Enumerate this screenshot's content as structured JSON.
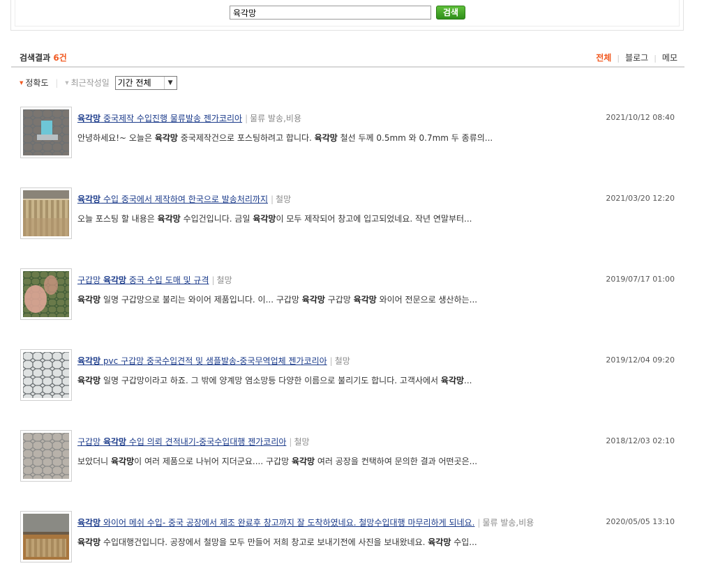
{
  "search": {
    "value": "육각망",
    "button_label": "검색"
  },
  "results_header": {
    "label": "검색결과",
    "count": "6건"
  },
  "view_tabs": [
    "전체",
    "블로그",
    "메모"
  ],
  "sort": {
    "accuracy": "정확도",
    "recent": "최근작성일",
    "period": "기간 전체"
  },
  "results": [
    {
      "title": [
        [
          "육각망",
          true
        ],
        [
          " 중국제작 수입진행 물류발송 젠가코리아",
          false
        ]
      ],
      "category": "물류 발송,비용",
      "date": "2021/10/12 08:40",
      "desc": [
        [
          "안녕하세요!~ 오늘은 ",
          false
        ],
        [
          "육각망",
          true
        ],
        [
          " 중국제작건으로 포스팅하려고 합니다. ",
          false
        ],
        [
          "육각망",
          true
        ],
        [
          " 철선 두께 0.5mm 와 0.7mm 두 종류의...",
          false
        ]
      ]
    },
    {
      "title": [
        [
          "육각망",
          true
        ],
        [
          " 수입 중국에서 제작하여 한국으로 발송처리까지",
          false
        ]
      ],
      "category": "철망",
      "date": "2021/03/20 12:20",
      "desc": [
        [
          "오늘 포스팅 할 내용은 ",
          false
        ],
        [
          "육각망",
          true
        ],
        [
          " 수입건입니다. 금일 ",
          false
        ],
        [
          "육각망",
          true
        ],
        [
          "이 모두 제작되어 창고에 입고되었네요. 작년 연말부터...",
          false
        ]
      ]
    },
    {
      "title": [
        [
          "구갑망 ",
          false
        ],
        [
          "육각망",
          true
        ],
        [
          " 중국 수입 도매 및 규격",
          false
        ]
      ],
      "category": "철망",
      "date": "2019/07/17 01:00",
      "desc": [
        [
          "육각망",
          true
        ],
        [
          " 일명 구갑망으로 불리는 와이어 제품입니다. 이... 구갑망 ",
          false
        ],
        [
          "육각망",
          true
        ],
        [
          " 구갑망 ",
          false
        ],
        [
          "육각망",
          true
        ],
        [
          " 와이어 전문으로 생산하는...",
          false
        ]
      ]
    },
    {
      "title": [
        [
          "육각망",
          true
        ],
        [
          " pvc 구갑망 중국수입견적 및 샘플발송-중국무역업체 젠가코리아",
          false
        ]
      ],
      "category": "철망",
      "date": "2019/12/04 09:20",
      "desc": [
        [
          "육각망",
          true
        ],
        [
          " 일명 구갑망이라고 하죠. 그 밖에 양계망 염소망등 다양한 이름으로 불리기도 합니다. 고객사에서 ",
          false
        ],
        [
          "육각망",
          true
        ],
        [
          "...",
          false
        ]
      ]
    },
    {
      "title": [
        [
          "구갑망 ",
          false
        ],
        [
          "육각망",
          true
        ],
        [
          " 수입 의뢰 견적내기-중국수입대행 젠가코리아",
          false
        ]
      ],
      "category": "철망",
      "date": "2018/12/03 02:10",
      "desc": [
        [
          "보았더니 ",
          false
        ],
        [
          "육각망",
          true
        ],
        [
          "이 여러 제품으로 나뉘어 지더군요.... 구갑망 ",
          false
        ],
        [
          "육각망",
          true
        ],
        [
          " 여러 공장을 컨택하여 문의한 결과 어떤곳은...",
          false
        ]
      ]
    },
    {
      "title": [
        [
          "육각망",
          true
        ],
        [
          " 와이어 메쉬 수입- 중국 공장에서 제조 완료후 창고까지 잘 도착하였네요. 철망수입대행 마무리하게 되네요.",
          false
        ]
      ],
      "category": "물류 발송,비용",
      "date": "2020/05/05 13:10",
      "desc": [
        [
          "육각망",
          true
        ],
        [
          " 수입대행건입니다. 공장에서 철망을 모두 만들어 저희 창고로 보내기전에 사진을 보내왔네요. ",
          false
        ],
        [
          "육각망",
          true
        ],
        [
          " 수입...",
          false
        ]
      ]
    }
  ]
}
